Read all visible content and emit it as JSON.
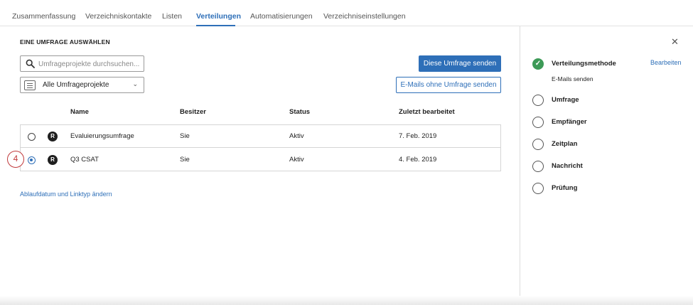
{
  "tabs": [
    {
      "label": "Zusammenfassung",
      "active": false
    },
    {
      "label": "Verzeichniskontakte",
      "active": false
    },
    {
      "label": "Listen",
      "active": false
    },
    {
      "label": "Verteilungen",
      "active": true
    },
    {
      "label": "Automatisierungen",
      "active": false
    },
    {
      "label": "Verzeichniseinstellungen",
      "active": false
    }
  ],
  "main": {
    "section_title": "EINE UMFRAGE AUSWÄHLEN",
    "search": {
      "placeholder": "Umfrageprojekte durchsuchen...",
      "value": "",
      "icon": "search-icon"
    },
    "filter": {
      "selected": "Alle Umfrageprojekte",
      "icon": "list-icon"
    },
    "send_button": "Diese Umfrage senden",
    "send_without_button": "E-Mails ohne Umfrage senden",
    "table": {
      "columns": [
        "Name",
        "Besitzer",
        "Status",
        "Zuletzt bearbeitet"
      ],
      "rows": [
        {
          "badge": "R",
          "name": "Evaluierungsumfrage",
          "owner": "Sie",
          "status": "Aktiv",
          "edited": "7. Feb. 2019",
          "selected": false
        },
        {
          "badge": "R",
          "name": "Q3 CSAT",
          "owner": "Sie",
          "status": "Aktiv",
          "edited": "4. Feb. 2019",
          "selected": true
        }
      ]
    },
    "step_marker": "4",
    "bottom_link": "Ablaufdatum und Linktyp ändern"
  },
  "sidebar": {
    "close_icon": "close-icon",
    "edit_label": "Bearbeiten",
    "steps": [
      {
        "label": "Verteilungsmethode",
        "sub": "E-Mails senden",
        "done": true
      },
      {
        "label": "Umfrage",
        "done": false
      },
      {
        "label": "Empfänger",
        "done": false
      },
      {
        "label": "Zeitplan",
        "done": false
      },
      {
        "label": "Nachricht",
        "done": false
      },
      {
        "label": "Prüfung",
        "done": false
      }
    ]
  },
  "colors": {
    "accent": "#2e6fb8",
    "success": "#3d9a57",
    "marker": "#c0393b"
  }
}
